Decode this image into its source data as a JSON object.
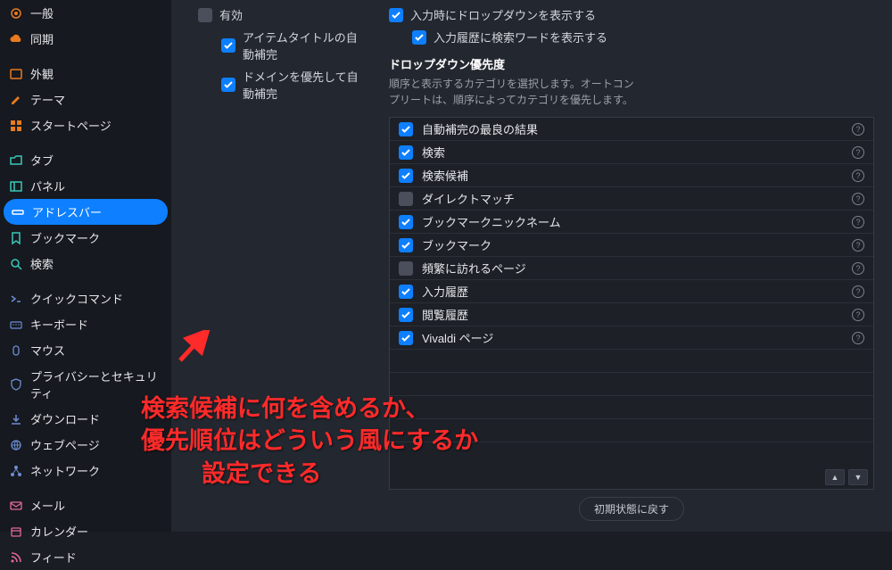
{
  "sidebar": {
    "items": [
      {
        "label": "一般",
        "icon": "gear"
      },
      {
        "label": "同期",
        "icon": "cloud"
      },
      {
        "label": "外観",
        "icon": "appearance"
      },
      {
        "label": "テーマ",
        "icon": "brush"
      },
      {
        "label": "スタートページ",
        "icon": "grid"
      },
      {
        "label": "タブ",
        "icon": "tab"
      },
      {
        "label": "パネル",
        "icon": "panel"
      },
      {
        "label": "アドレスバー",
        "icon": "addressbar",
        "active": true
      },
      {
        "label": "ブックマーク",
        "icon": "bookmark"
      },
      {
        "label": "検索",
        "icon": "search"
      },
      {
        "label": "クイックコマンド",
        "icon": "command"
      },
      {
        "label": "キーボード",
        "icon": "keyboard"
      },
      {
        "label": "マウス",
        "icon": "mouse"
      },
      {
        "label": "プライバシーとセキュリティ",
        "icon": "shield"
      },
      {
        "label": "ダウンロード",
        "icon": "download"
      },
      {
        "label": "ウェブページ",
        "icon": "globe"
      },
      {
        "label": "ネットワーク",
        "icon": "network"
      },
      {
        "label": "メール",
        "icon": "mail"
      },
      {
        "label": "カレンダー",
        "icon": "calendar"
      },
      {
        "label": "フィード",
        "icon": "feed"
      }
    ]
  },
  "left_opts": [
    {
      "label": "有効",
      "checked": false
    },
    {
      "label": "アイテムタイトルの自動補完",
      "checked": true
    },
    {
      "label": "ドメインを優先して自動補完",
      "checked": true
    }
  ],
  "right_opts": [
    {
      "label": "入力時にドロップダウンを表示する",
      "checked": true
    },
    {
      "label": "入力履歴に検索ワードを表示する",
      "checked": true
    }
  ],
  "priority": {
    "title": "ドロップダウン優先度",
    "desc1": "順序と表示するカテゴリを選択します。オートコン",
    "desc2": "プリートは、順序によってカテゴリを優先します。",
    "items": [
      {
        "label": "自動補完の最良の結果",
        "checked": true,
        "help": true
      },
      {
        "label": "検索",
        "checked": true,
        "help": true
      },
      {
        "label": "検索候補",
        "checked": true,
        "help": true
      },
      {
        "label": "ダイレクトマッチ",
        "checked": false,
        "help": true
      },
      {
        "label": "ブックマークニックネーム",
        "checked": true,
        "help": true
      },
      {
        "label": "ブックマーク",
        "checked": true,
        "help": true
      },
      {
        "label": "頻繁に訪れるページ",
        "checked": false,
        "help": true
      },
      {
        "label": "入力履歴",
        "checked": true,
        "help": true
      },
      {
        "label": "閲覧履歴",
        "checked": true,
        "help": true
      },
      {
        "label": "Vivaldi ページ",
        "checked": true,
        "help": true
      }
    ],
    "reset": "初期状態に戻す"
  },
  "annotation": {
    "line1": "検索候補に何を含めるか、",
    "line2": "優先順位はどういう風にするか",
    "line3": "設定できる"
  }
}
